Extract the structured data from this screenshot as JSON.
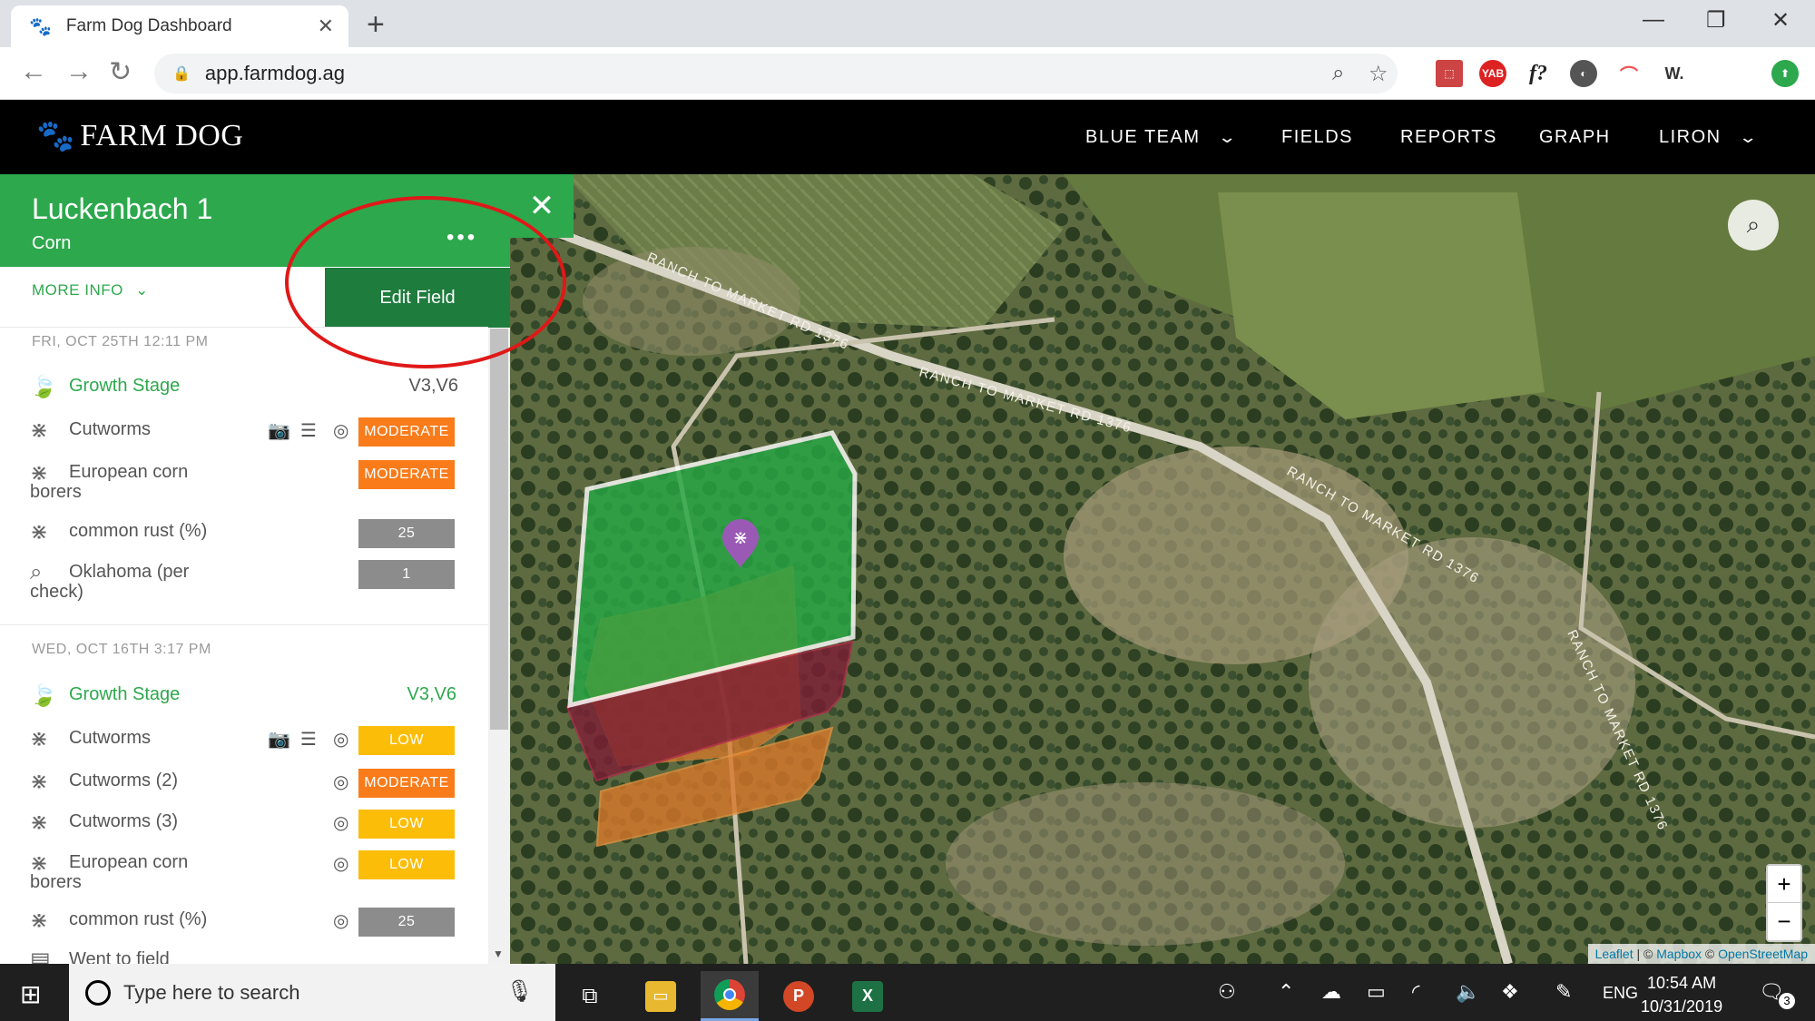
{
  "browser": {
    "tab_title": "Farm Dog Dashboard",
    "url": "app.farmdog.ag",
    "new_tab": "+",
    "ext_yab": "YAB",
    "ext_f": "f?",
    "ext_w": "W."
  },
  "header": {
    "brand": "FARM DOG",
    "nav": [
      {
        "label": "BLUE TEAM"
      },
      {
        "label": "FIELDS"
      },
      {
        "label": "REPORTS"
      },
      {
        "label": "GRAPH"
      },
      {
        "label": "LIRON"
      }
    ]
  },
  "panel": {
    "field_name": "Luckenbach 1",
    "crop": "Corn",
    "more_dots": "•••",
    "more_info": "MORE INFO",
    "edit_field": "Edit Field",
    "sections": [
      {
        "date": "FRI, OCT 25TH 12:11 PM",
        "rows": [
          {
            "icon": "leaf",
            "label": "Growth Stage",
            "value": "V3,V6",
            "type": "text"
          },
          {
            "icon": "bug",
            "label": "Cutworms",
            "value": "MODERATE",
            "type": "moderate"
          },
          {
            "icon": "bug",
            "label_1": "European corn",
            "label_2": "borers",
            "value": "MODERATE",
            "type": "moderate"
          },
          {
            "icon": "bug",
            "label": "common rust (%)",
            "value": "25",
            "type": "num"
          },
          {
            "icon": "search",
            "label_1": "Oklahoma (per",
            "label_2": "check)",
            "value": "1",
            "type": "num"
          }
        ]
      },
      {
        "date": "WED, OCT 16TH 3:17 PM",
        "rows": [
          {
            "icon": "leaf",
            "label": "Growth Stage",
            "value": "V3,V6",
            "type": "text"
          },
          {
            "icon": "bug",
            "label": "Cutworms",
            "value": "LOW",
            "type": "low"
          },
          {
            "icon": "bug",
            "label": "Cutworms (2)",
            "value": "MODERATE",
            "type": "moderate"
          },
          {
            "icon": "bug",
            "label": "Cutworms (3)",
            "value": "LOW",
            "type": "low"
          },
          {
            "icon": "bug",
            "label_1": "European corn",
            "label_2": "borers",
            "value": "LOW",
            "type": "low"
          },
          {
            "icon": "bug",
            "label": "common rust (%)",
            "value": "25",
            "type": "num"
          },
          {
            "icon": "calendar",
            "label": "Went to field",
            "value": "",
            "type": "none"
          }
        ]
      }
    ]
  },
  "map": {
    "roads": [
      "RANCH TO MARKET RD 1376",
      "RANCH TO MARKET RD 1376",
      "RANCH TO MARKET RD 1376",
      "RANCH TO MARKET RD 1376",
      "RANCH TO MARKET RD 1376"
    ],
    "attribution": {
      "leaflet": "Leaflet",
      "sep": " | © ",
      "mapbox": "Mapbox",
      "sep2": " © ",
      "osm": "OpenStreetMap"
    },
    "zoom_in": "+",
    "zoom_out": "−",
    "colors": {
      "field": "#27a844",
      "zone_red": "#7d1f35",
      "zone_orange": "#d8782a",
      "pin": "#9b59b6"
    }
  },
  "taskbar": {
    "search_placeholder": "Type here to search",
    "lang": "ENG",
    "time": "10:54 AM",
    "date": "10/31/2019",
    "notifications": "3"
  }
}
